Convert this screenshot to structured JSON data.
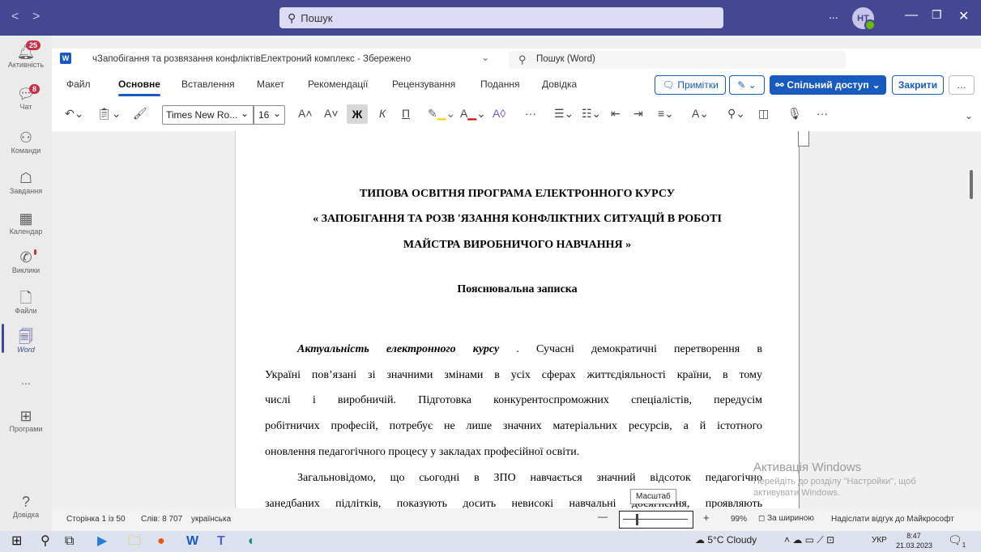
{
  "teams": {
    "search_placeholder": "Пошук",
    "more": "...",
    "avatar_initials": "НТ"
  },
  "rail": {
    "activity": {
      "label": "Активність",
      "badge": "25"
    },
    "chat": {
      "label": "Чат",
      "badge": "8"
    },
    "teams": {
      "label": "Команди"
    },
    "assignments": {
      "label": "Завдання"
    },
    "calendar": {
      "label": "Календар"
    },
    "calls": {
      "label": "Виклики"
    },
    "files": {
      "label": "Файли"
    },
    "word": {
      "label": "Word"
    },
    "more": "...",
    "apps": {
      "label": "Програми"
    },
    "help": {
      "label": "Довідка"
    }
  },
  "word": {
    "doc_title": "чЗапобігання та розвязання конфліктівЕлектроний комплекс - Збережено",
    "title_chevron": "⌄",
    "search_placeholder": "Пошук (Word)",
    "tabs": [
      "Файл",
      "Основне",
      "Вставлення",
      "Макет",
      "Рекомендації",
      "Рецензування",
      "Подання",
      "Довідка"
    ],
    "comments_btn": "Примітки",
    "share_btn": "Спільний доступ",
    "close_btn": "Закрити",
    "font_name": "Times New Ro...",
    "font_size": "16"
  },
  "document": {
    "title_line1": "ТИПОВА ОСВІТНЯ ПРОГРАМА ЕЛЕКТРОННОГО КУРСУ",
    "title_line2": "« ЗАПОБІГАННЯ ТА РОЗВ 'ЯЗАННЯ КОНФЛІКТНИХ СИТУАЦІЙ В РОБОТІ",
    "title_line3": "МАЙСТРА ВИРОБНИЧОГО НАВЧАННЯ »",
    "subtitle": "Пояснювальна записка",
    "p1_lead": "Актуальність електронного курсу",
    "p1_line1_rest": " . Сучасні демократичні перетворення в",
    "p1_line2": "Україні пов’язані зі значними змінами в усіх сферах життєдіяльності країни, в тому",
    "p1_line3": "числі і виробничій. Підготовка конкурентоспроможних спеціалістів, передусім",
    "p1_line4": "робітничих професій, потребує не лише значних матеріальних ресурсів, а й істотного",
    "p1_line5": "оновлення педагогічного процесу у закладах професійної освіти.",
    "p2_line1": "Загальновідомо, що сьогодні в ЗПО навчається значний відсоток педагогічно",
    "p2_line2": "занедбаних підлітків, показують досить невисокі навчальні досягнення, проявляють"
  },
  "status": {
    "page": "Сторінка 1 із 50",
    "words": "Слів: 8 707",
    "language": "українська",
    "zoom_tooltip": "Масштаб",
    "zoom_minus": "—",
    "zoom_plus": "+",
    "zoom_value": "99%",
    "fit_width": "За шириною",
    "feedback": "Надіслати відгук до Майкрософт"
  },
  "watermark": {
    "line1": "Активація Windows",
    "line2": "Перейдіть до розділу \"Настройки\", щоб",
    "line3": "активувати Windows."
  },
  "taskbar": {
    "weather": "5°C  Cloudy",
    "lang": "УКР",
    "time": "8:47",
    "date": "21.03.2023",
    "notif_count": "1"
  }
}
